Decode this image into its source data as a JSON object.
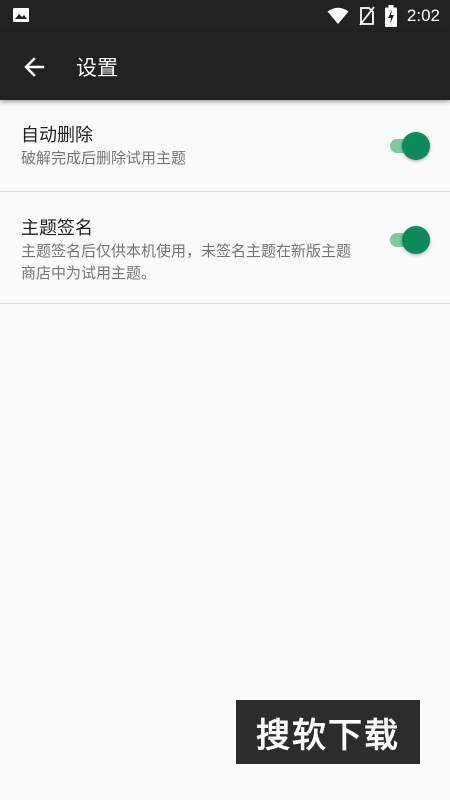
{
  "status_bar": {
    "time": "2:02",
    "icons": [
      "image-notification-icon",
      "wifi-icon",
      "no-sim-icon",
      "battery-charging-icon"
    ]
  },
  "toolbar": {
    "title": "设置",
    "back_icon": "arrow-back-icon"
  },
  "settings": [
    {
      "title": "自动删除",
      "summary": "破解完成后删除试用主题",
      "enabled": true
    },
    {
      "title": "主题签名",
      "summary": "主题签名后仅供本机使用，未签名主题在新版主题商店中为试用主题。",
      "enabled": true
    }
  ],
  "colors": {
    "bar": "#222222",
    "accent": "#0b8a5b",
    "track": "#7fc8a5",
    "background": "#fafafa"
  },
  "watermark": "搜软下载"
}
